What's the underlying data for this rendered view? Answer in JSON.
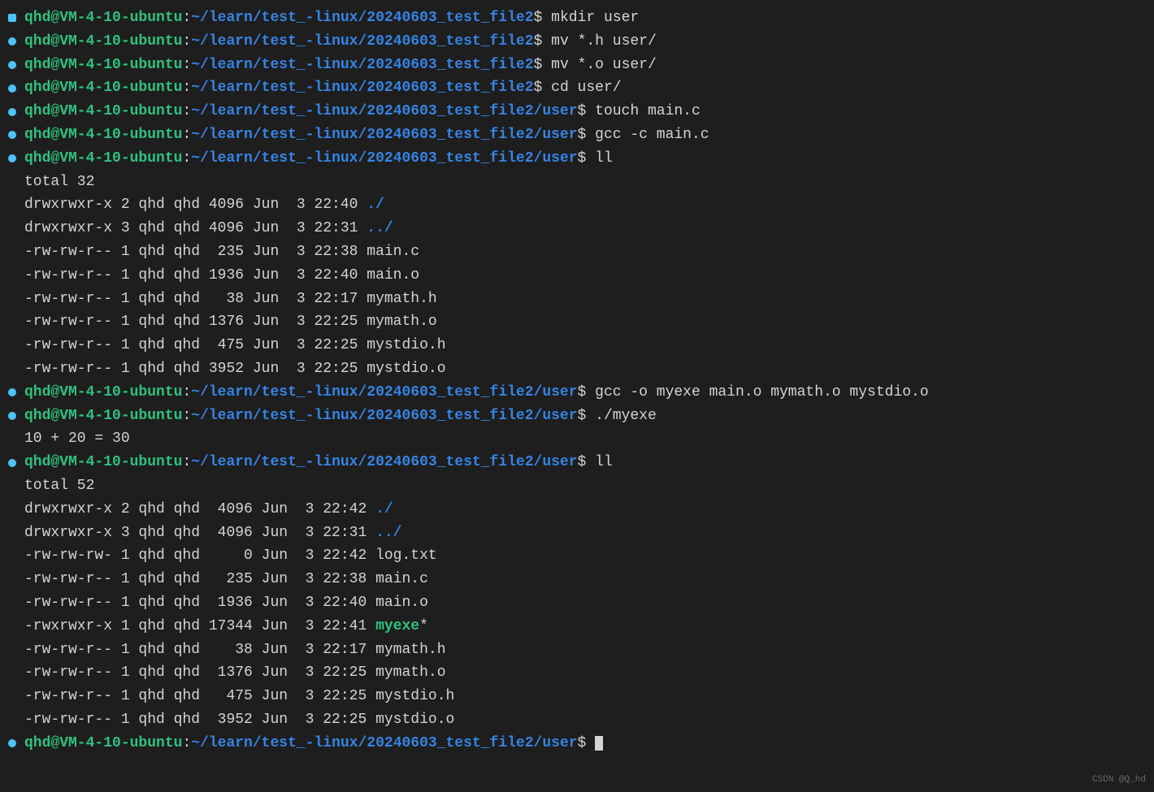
{
  "prompt": {
    "user": "qhd@VM-4-10-ubuntu",
    "path_base": "~/learn/test_-linux/20240603_test_file2",
    "path_user": "~/learn/test_-linux/20240603_test_file2/user",
    "symbol": "$"
  },
  "commands": {
    "c1": "mkdir user",
    "c2": "mv *.h user/",
    "c3": "mv *.o user/",
    "c4": "cd user/",
    "c5": "touch main.c",
    "c6": "gcc -c main.c",
    "c7": "ll",
    "c8": "gcc -o myexe main.o mymath.o mystdio.o",
    "c9": "./myexe",
    "c10": "ll"
  },
  "listing1": {
    "total": "total 32",
    "rows": {
      "r1": {
        "pre": "drwxrwxr-x 2 qhd qhd 4096 Jun  3 22:40 ",
        "name": "./"
      },
      "r2": {
        "pre": "drwxrwxr-x 3 qhd qhd 4096 Jun  3 22:31 ",
        "name": "../"
      },
      "r3": {
        "pre": "-rw-rw-r-- 1 qhd qhd  235 Jun  3 22:38 ",
        "name": "main.c"
      },
      "r4": {
        "pre": "-rw-rw-r-- 1 qhd qhd 1936 Jun  3 22:40 ",
        "name": "main.o"
      },
      "r5": {
        "pre": "-rw-rw-r-- 1 qhd qhd   38 Jun  3 22:17 ",
        "name": "mymath.h"
      },
      "r6": {
        "pre": "-rw-rw-r-- 1 qhd qhd 1376 Jun  3 22:25 ",
        "name": "mymath.o"
      },
      "r7": {
        "pre": "-rw-rw-r-- 1 qhd qhd  475 Jun  3 22:25 ",
        "name": "mystdio.h"
      },
      "r8": {
        "pre": "-rw-rw-r-- 1 qhd qhd 3952 Jun  3 22:25 ",
        "name": "mystdio.o"
      }
    }
  },
  "output1": "10 + 20 = 30",
  "listing2": {
    "total": "total 52",
    "rows": {
      "r1": {
        "pre": "drwxrwxr-x 2 qhd qhd  4096 Jun  3 22:42 ",
        "name": "./"
      },
      "r2": {
        "pre": "drwxrwxr-x 3 qhd qhd  4096 Jun  3 22:31 ",
        "name": "../"
      },
      "r3": {
        "pre": "-rw-rw-rw- 1 qhd qhd     0 Jun  3 22:42 ",
        "name": "log.txt"
      },
      "r4": {
        "pre": "-rw-rw-r-- 1 qhd qhd   235 Jun  3 22:38 ",
        "name": "main.c"
      },
      "r5": {
        "pre": "-rw-rw-r-- 1 qhd qhd  1936 Jun  3 22:40 ",
        "name": "main.o"
      },
      "r6": {
        "pre": "-rwxrwxr-x 1 qhd qhd 17344 Jun  3 22:41 ",
        "name": "myexe",
        "suffix": "*"
      },
      "r7": {
        "pre": "-rw-rw-r-- 1 qhd qhd    38 Jun  3 22:17 ",
        "name": "mymath.h"
      },
      "r8": {
        "pre": "-rw-rw-r-- 1 qhd qhd  1376 Jun  3 22:25 ",
        "name": "mymath.o"
      },
      "r9": {
        "pre": "-rw-rw-r-- 1 qhd qhd   475 Jun  3 22:25 ",
        "name": "mystdio.h"
      },
      "r10": {
        "pre": "-rw-rw-r-- 1 qhd qhd  3952 Jun  3 22:25 ",
        "name": "mystdio.o"
      }
    }
  },
  "watermark": "CSDN @Q_hd"
}
